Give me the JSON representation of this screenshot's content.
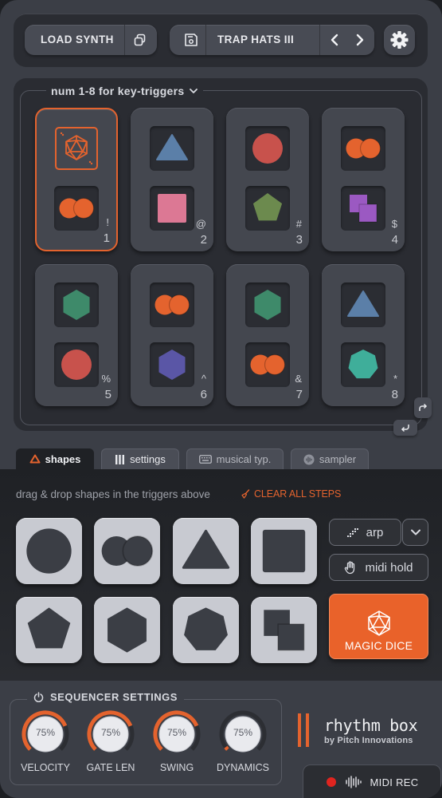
{
  "topbar": {
    "load_synth_label": "LOAD SYNTH",
    "preset_name": "TRAP HATS III"
  },
  "pads": {
    "hint": "num 1-8 for key-triggers",
    "items": [
      {
        "number": "1",
        "key": "!",
        "top": "dice",
        "bottom": "double-circle",
        "top_color": "#e4632e",
        "bottom_color": "#e4632e",
        "selected": true
      },
      {
        "number": "2",
        "key": "@",
        "top": "triangle",
        "bottom": "square",
        "top_color": "#5b7fa8",
        "bottom_color": "#dc7894"
      },
      {
        "number": "3",
        "key": "#",
        "top": "circle",
        "bottom": "pentagon",
        "top_color": "#c8524c",
        "bottom_color": "#6c8a4e"
      },
      {
        "number": "4",
        "key": "$",
        "top": "double-circle",
        "bottom": "two-squares",
        "top_color": "#e4632e",
        "bottom_color": "#9b59c2"
      },
      {
        "number": "5",
        "key": "%",
        "top": "hexagon",
        "bottom": "circle",
        "top_color": "#3e8a6a",
        "bottom_color": "#c8524c"
      },
      {
        "number": "6",
        "key": "^",
        "top": "double-circle",
        "bottom": "hexagon",
        "top_color": "#e4632e",
        "bottom_color": "#5a56a6"
      },
      {
        "number": "7",
        "key": "&",
        "top": "hexagon",
        "bottom": "double-circle",
        "top_color": "#3e8a6a",
        "bottom_color": "#e4632e"
      },
      {
        "number": "8",
        "key": "*",
        "top": "triangle",
        "bottom": "heptagon",
        "top_color": "#5b7fa8",
        "bottom_color": "#3fae9a"
      }
    ]
  },
  "tabs": [
    {
      "label": "shapes",
      "icon": "triangle-icon",
      "active": true
    },
    {
      "label": "settings",
      "icon": "bars-icon"
    },
    {
      "label": "musical typ.",
      "icon": "keyboard-icon"
    },
    {
      "label": "sampler",
      "icon": "waveform-icon"
    }
  ],
  "shapes_panel": {
    "hint": "drag & drop shapes in the triggers above",
    "clear_label": "CLEAR ALL STEPS",
    "shapes": [
      "circle",
      "double-circle",
      "triangle",
      "square",
      "pentagon",
      "hexagon",
      "heptagon",
      "two-squares"
    ],
    "arp_label": "arp",
    "midi_hold_label": "midi hold",
    "magic_label": "MAGIC DICE"
  },
  "sequencer": {
    "title": "SEQUENCER SETTINGS",
    "knobs": [
      {
        "label": "VELOCITY",
        "value": "75%",
        "level": 0.75
      },
      {
        "label": "GATE LEN",
        "value": "75%",
        "level": 0.75
      },
      {
        "label": "SWING",
        "value": "75%",
        "level": 0.75
      },
      {
        "label": "DYNAMICS",
        "value": "75%",
        "level": 0.0
      }
    ]
  },
  "brand": {
    "name": "rhythm box",
    "sub": "by Pitch Innovations"
  },
  "midi_rec_label": "MIDI REC",
  "colors": {
    "accent": "#e4632e",
    "background": "#3b3e46",
    "panel": "#2a2c32"
  }
}
